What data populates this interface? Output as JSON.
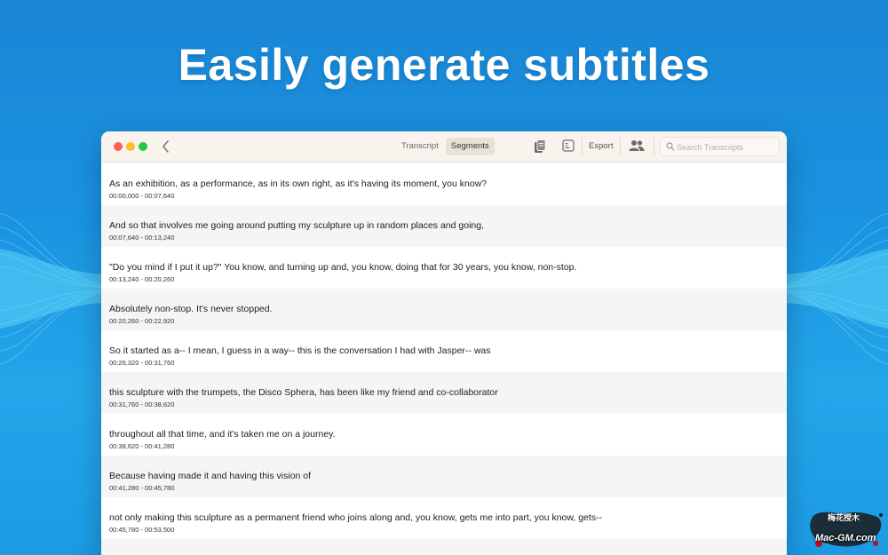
{
  "headline": "Easily generate subtitles",
  "colors": {
    "background_top": "#1a86d6",
    "background_bottom": "#23a6ea",
    "titlebar": "#f8f3ec",
    "row_alt": "#f5f5f5",
    "traffic_red": "#ff5f57",
    "traffic_yellow": "#febc2e",
    "traffic_green": "#28c840"
  },
  "toolbar": {
    "back_icon": "chevron-left-icon",
    "tabs": [
      {
        "label": "Transcript",
        "active": false
      },
      {
        "label": "Segments",
        "active": true
      }
    ],
    "copy_icon": "copy-document-icon",
    "sidebar_icon": "sidebar-toggle-icon",
    "export_label": "Export",
    "people_icon": "people-icon",
    "search_icon": "magnifying-glass-icon",
    "search_placeholder": "Search Transcripts"
  },
  "segments": [
    {
      "text": "As an exhibition, as a performance, as in its own right, as it's having its moment, you know?",
      "time": "00:00,000 - 00:07,640"
    },
    {
      "text": "And so that involves me going around putting my sculpture up in random places and going,",
      "time": "00:07,640 - 00:13,240"
    },
    {
      "text": "\"Do you mind if I put it up?\" You know, and turning up and, you know, doing that for 30 years, you know, non-stop.",
      "time": "00:13,240 - 00:20,260"
    },
    {
      "text": "Absolutely non-stop. It's never stopped.",
      "time": "00:20,260 - 00:22,920"
    },
    {
      "text": "So it started as a-- I mean, I guess in a way-- this is the conversation I had with Jasper-- was",
      "time": "00:26,320 - 00:31,760"
    },
    {
      "text": "this sculpture with the trumpets, the Disco Sphera, has been like my friend and co-collaborator",
      "time": "00:31,760 - 00:38,620"
    },
    {
      "text": "throughout all that time, and it's taken me on a journey.",
      "time": "00:38,620 - 00:41,280"
    },
    {
      "text": "Because having made it and having this vision of",
      "time": "00:41,280 - 00:45,780"
    },
    {
      "text": "not only making this sculpture as a permanent friend who joins along and, you know, gets me into part, you know, gets--",
      "time": "00:45,780 - 00:53,500"
    },
    {
      "text": "",
      "time": ""
    }
  ],
  "watermark": {
    "line1": "梅花授木",
    "line2": "Mac-GM.com"
  }
}
